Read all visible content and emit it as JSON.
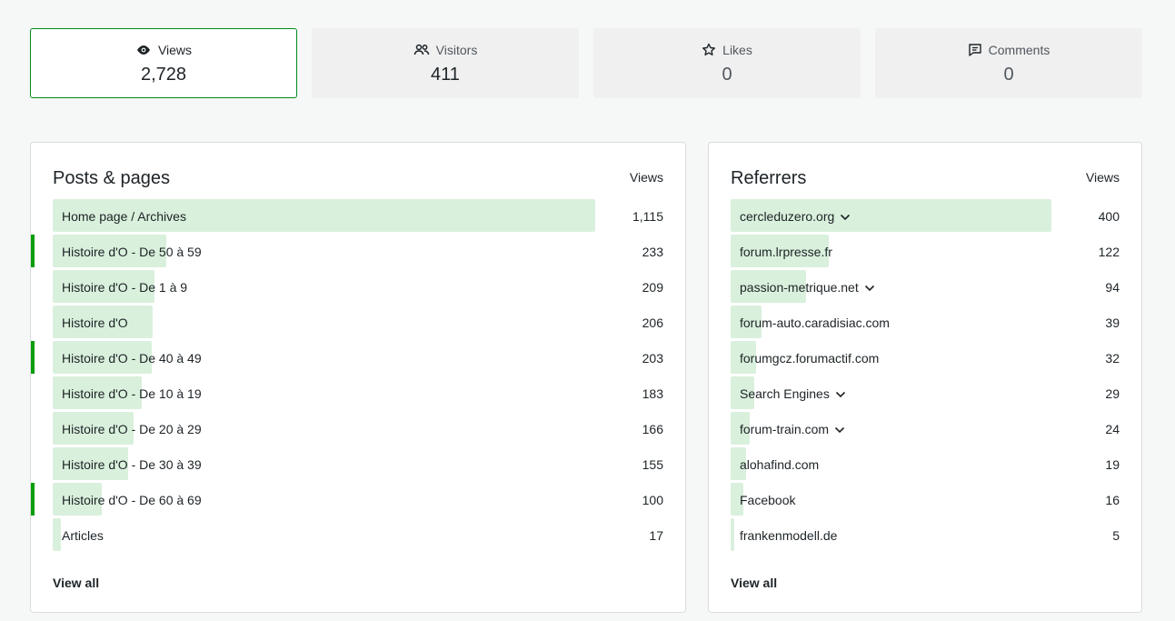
{
  "tiles": [
    {
      "label": "Views",
      "value": "2,728",
      "icon": "eye-icon",
      "selected": true
    },
    {
      "label": "Visitors",
      "value": "411",
      "icon": "people-icon",
      "selected": false
    },
    {
      "label": "Likes",
      "value": "0",
      "icon": "star-icon",
      "selected": false
    },
    {
      "label": "Comments",
      "value": "0",
      "icon": "comment-icon",
      "selected": false
    }
  ],
  "posts": {
    "title": "Posts & pages",
    "column_label": "Views",
    "view_all": "View all",
    "max": 1115,
    "rows": [
      {
        "label": "Home page / Archives",
        "count": "1,115",
        "value": 1115,
        "highlight": false
      },
      {
        "label": "Histoire d'O - De 50 à 59",
        "count": "233",
        "value": 233,
        "highlight": true
      },
      {
        "label": "Histoire d'O - De 1 à 9",
        "count": "209",
        "value": 209,
        "highlight": false
      },
      {
        "label": "Histoire d'O",
        "count": "206",
        "value": 206,
        "highlight": false
      },
      {
        "label": "Histoire d'O - De 40 à 49",
        "count": "203",
        "value": 203,
        "highlight": true
      },
      {
        "label": "Histoire d'O - De 10 à 19",
        "count": "183",
        "value": 183,
        "highlight": false
      },
      {
        "label": "Histoire d'O - De 20 à 29",
        "count": "166",
        "value": 166,
        "highlight": false
      },
      {
        "label": "Histoire d'O - De 30 à 39",
        "count": "155",
        "value": 155,
        "highlight": false
      },
      {
        "label": "Histoire d'O - De 60 à 69",
        "count": "100",
        "value": 100,
        "highlight": true
      },
      {
        "label": "Articles",
        "count": "17",
        "value": 17,
        "highlight": false
      }
    ]
  },
  "referrers": {
    "title": "Referrers",
    "column_label": "Views",
    "view_all": "View all",
    "max": 400,
    "rows": [
      {
        "label": "cercleduzero.org",
        "count": "400",
        "value": 400,
        "expandable": true
      },
      {
        "label": "forum.lrpresse.fr",
        "count": "122",
        "value": 122,
        "expandable": false
      },
      {
        "label": "passion-metrique.net",
        "count": "94",
        "value": 94,
        "expandable": true
      },
      {
        "label": "forum-auto.caradisiac.com",
        "count": "39",
        "value": 39,
        "expandable": false
      },
      {
        "label": "forumgcz.forumactif.com",
        "count": "32",
        "value": 32,
        "expandable": false
      },
      {
        "label": "Search Engines",
        "count": "29",
        "value": 29,
        "expandable": true
      },
      {
        "label": "forum-train.com",
        "count": "24",
        "value": 24,
        "expandable": true
      },
      {
        "label": "alohafind.com",
        "count": "19",
        "value": 19,
        "expandable": false
      },
      {
        "label": "Facebook",
        "count": "16",
        "value": 16,
        "expandable": false
      },
      {
        "label": "frankenmodell.de",
        "count": "5",
        "value": 5,
        "expandable": false
      }
    ]
  },
  "colors": {
    "accent": "#008a20",
    "bar": "#d9f0dc",
    "marker": "#069e08"
  }
}
